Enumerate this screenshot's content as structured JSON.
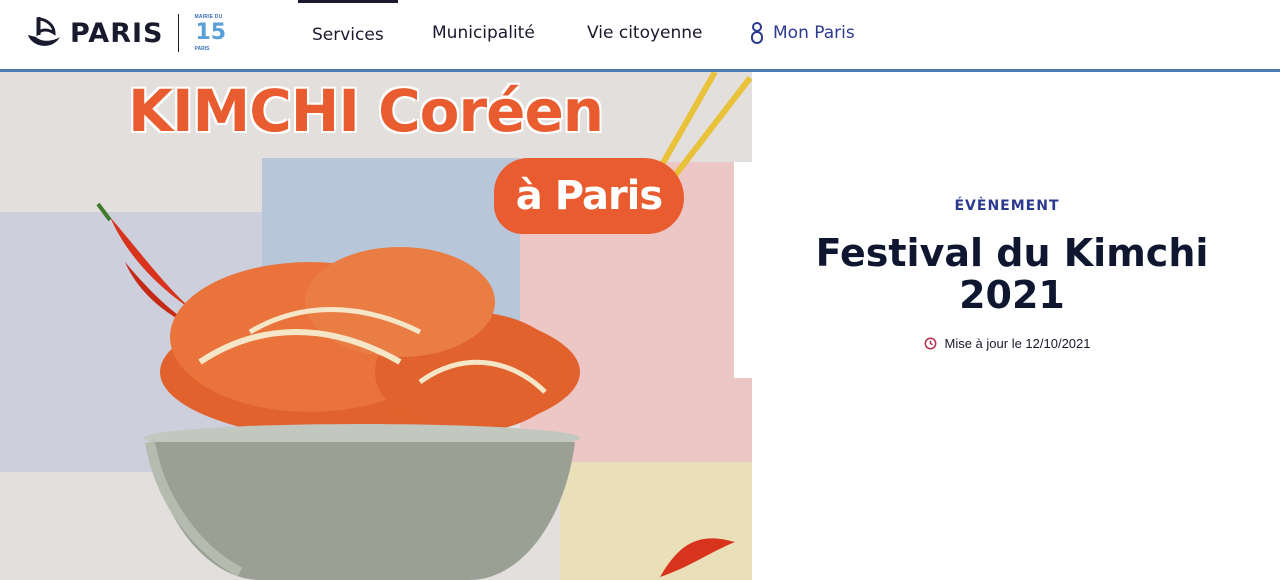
{
  "header": {
    "logo_text": "PARIS",
    "mairie_badge": {
      "top": "MAIRIE DU",
      "number": "15",
      "bottom": "PARIS"
    },
    "nav": [
      {
        "label": "Services",
        "active": true
      },
      {
        "label": "Municipalité",
        "active": false
      },
      {
        "label": "Vie citoyenne",
        "active": false
      }
    ],
    "account_label": "Mon Paris",
    "account_icon": "user-icon"
  },
  "hero": {
    "title": "KIMCHI Coréen",
    "badge": "à Paris"
  },
  "event": {
    "type": "ÉVÈNEMENT",
    "title": "Festival du Kimchi 2021",
    "updated": "Mise à jour le 12/10/2021",
    "updated_icon": "clock-icon"
  },
  "colors": {
    "accent_blue": "#2b3a8f",
    "header_border": "#4d7bb6",
    "kimchi_orange": "#e85c2f",
    "clock_red": "#b8304f"
  }
}
